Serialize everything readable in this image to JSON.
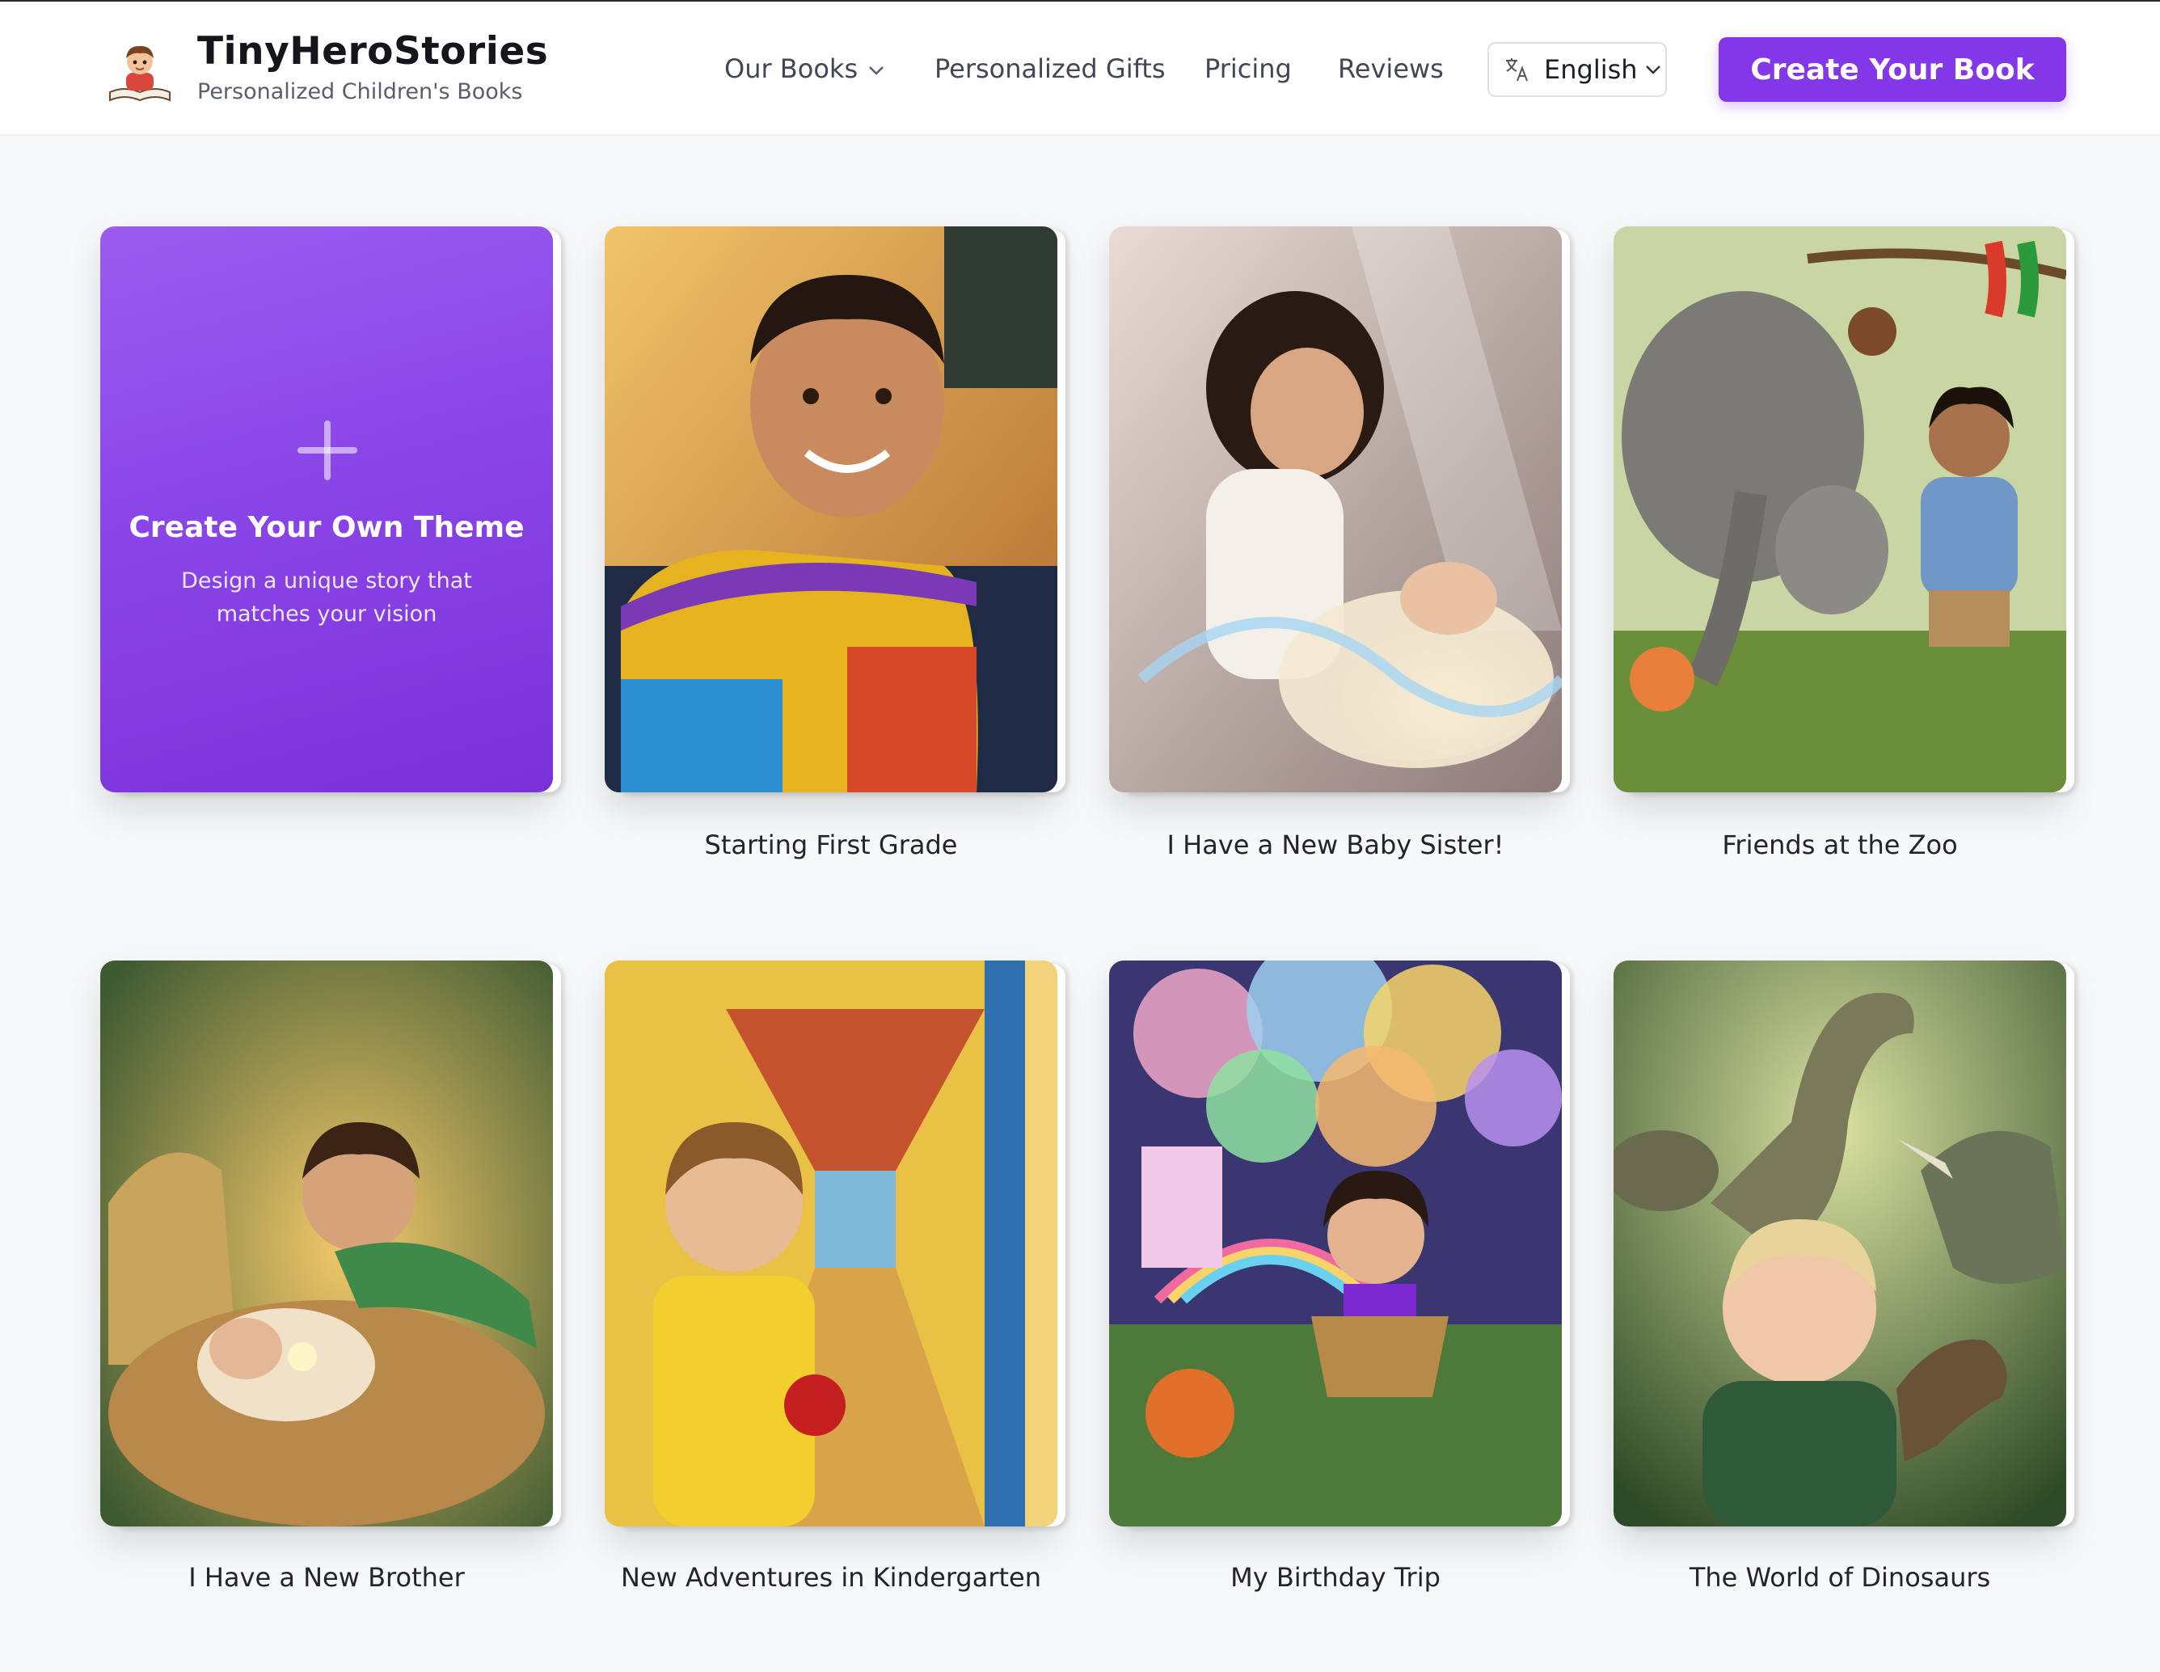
{
  "header": {
    "brand_title": "TinyHeroStories",
    "brand_subtitle": "Personalized Children's Books",
    "nav": {
      "our_books": "Our Books",
      "personalized_gifts": "Personalized Gifts",
      "pricing": "Pricing",
      "reviews": "Reviews"
    },
    "language": "English",
    "cta_label": "Create Your Book"
  },
  "create_theme": {
    "title": "Create Your Own Theme",
    "subtitle": "Design a unique story that matches your vision"
  },
  "books": [
    {
      "title": "Starting First Grade"
    },
    {
      "title": "I Have a New Baby Sister!"
    },
    {
      "title": "Friends at the Zoo"
    },
    {
      "title": "I Have a New Brother"
    },
    {
      "title": "New Adventures in Kindergarten"
    },
    {
      "title": "My Birthday Trip"
    },
    {
      "title": "The World of Dinosaurs"
    }
  ],
  "colors": {
    "accent": "#8437e8",
    "page_background": "#f7f8fa"
  }
}
